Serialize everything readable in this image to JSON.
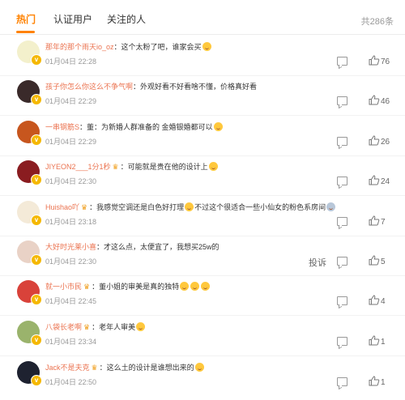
{
  "tabs": [
    {
      "label": "热门",
      "active": true
    },
    {
      "label": "认证用户",
      "active": false
    },
    {
      "label": "关注的人",
      "active": false
    }
  ],
  "total_count": "共286条",
  "report_label": "投诉",
  "comments": [
    {
      "username": "那年的那个雨天io_oz",
      "separator": "：",
      "text": "这个太粉了吧，谁家会买",
      "emoji_after": "laugh-emoji",
      "time": "01月04日 22:28",
      "likes": "76",
      "vip": false,
      "avatar_color": "#f3f0cc"
    },
    {
      "username": "孩子你怎么你这么不争气啊",
      "separator": "：",
      "text": "外观好看不好看啥不懂，价格真好看",
      "emoji_after": "",
      "time": "01月04日 22:29",
      "likes": "46",
      "vip": false,
      "avatar_color": "#3a2a2a"
    },
    {
      "username": "一串钢筋S",
      "separator": "：",
      "text": "董：为新婚人群准备的 金婚银婚都可以",
      "emoji_after": "smile-emoji",
      "time": "01月04日 22:29",
      "likes": "26",
      "vip": false,
      "avatar_color": "#c7561e"
    },
    {
      "username": "JIYEON2___1分1秒",
      "separator": "：",
      "text": "可能就是贵在他的设计上",
      "emoji_after": "smile-emoji",
      "time": "01月04日 22:30",
      "likes": "24",
      "vip": true,
      "avatar_color": "#8a1c20"
    },
    {
      "username": "Huishao吖",
      "separator": "：",
      "text": "我感觉空调还是白色好打理",
      "mid_text": "不过这个很适合一些小仙女的粉色系房间",
      "emoji_after": "laugh-emoji",
      "emoji_end": "cry-emoji",
      "time": "01月04日 23:18",
      "likes": "7",
      "vip": true,
      "avatar_color": "#f4ead8"
    },
    {
      "username": "大好时光莱小喜",
      "separator": "：",
      "text": "才这么点，太便宜了，我想买25w的",
      "emoji_after": "",
      "time": "01月04日 22:30",
      "likes": "5",
      "vip": false,
      "avatar_color": "#e9d2c6",
      "show_report": true
    },
    {
      "username": "就一小市民",
      "separator": "：",
      "text": "董小姐的审美是真的独特",
      "emoji_after": "laugh-emoji x3",
      "time": "01月04日 22:45",
      "likes": "4",
      "vip": true,
      "avatar_color": "#d9423a"
    },
    {
      "username": "八袋长老啊",
      "separator": "：",
      "text": "老年人审美",
      "emoji_after": "smile-emoji",
      "time": "01月04日 23:34",
      "likes": "1",
      "vip": true,
      "avatar_color": "#9ab36c"
    },
    {
      "username": "Jack不是夫克",
      "separator": "：",
      "text": "这么土的设计是谁想出来的",
      "emoji_after": "laugh-emoji",
      "time": "01月04日 22:50",
      "likes": "1",
      "vip": true,
      "avatar_color": "#1e2230"
    }
  ]
}
